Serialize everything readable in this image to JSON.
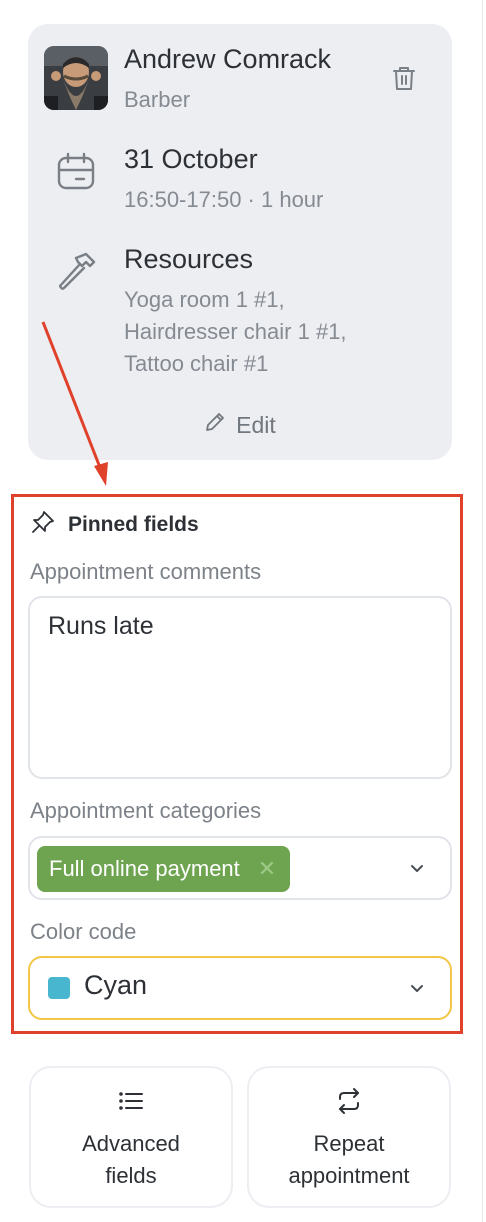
{
  "appointment": {
    "employee_name": "Andrew Comrack",
    "employee_role": "Barber",
    "date": "31 October",
    "time": "16:50-17:50 · 1 hour",
    "resources_title": "Resources",
    "resources_lines": [
      "Yoga room 1 #1,",
      "Hairdresser chair 1 #1,",
      "Tattoo chair #1"
    ],
    "edit_label": "Edit"
  },
  "pinned": {
    "header": "Pinned fields",
    "comments_label": "Appointment comments",
    "comments_value": "Runs late",
    "categories_label": "Appointment categories",
    "category_tag": "Full online payment",
    "category_tag_color": "#6ea450",
    "color_label": "Color code",
    "color_value": "Cyan",
    "color_swatch": "#49b6d0"
  },
  "actions": {
    "advanced_fields_label": [
      "Advanced",
      "fields"
    ],
    "repeat_label": [
      "Repeat",
      "appointment"
    ]
  },
  "colors": {
    "card_bg": "#eceef2",
    "annotation_red": "#e0412b",
    "focus_yellow": "#f3c64a"
  }
}
